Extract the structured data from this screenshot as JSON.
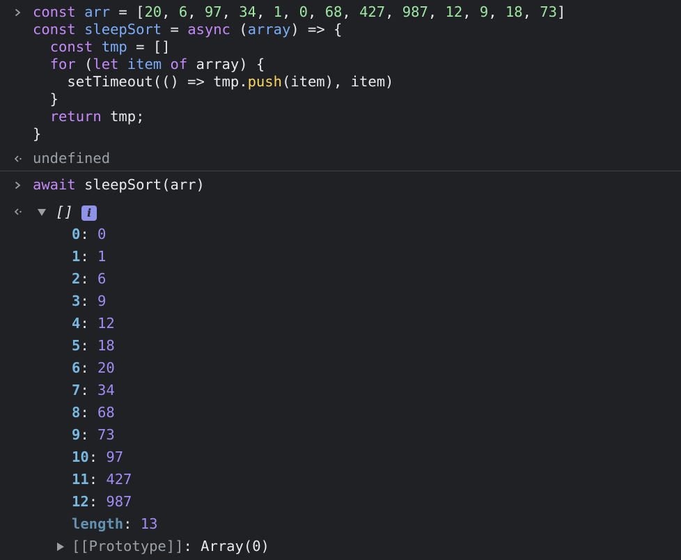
{
  "input1": {
    "lines": [
      [
        [
          "kw",
          "const "
        ],
        [
          "var",
          "arr"
        ],
        [
          "plain",
          " = ["
        ],
        [
          "num",
          "20"
        ],
        [
          "plain",
          ", "
        ],
        [
          "num",
          "6"
        ],
        [
          "plain",
          ", "
        ],
        [
          "num",
          "97"
        ],
        [
          "plain",
          ", "
        ],
        [
          "num",
          "34"
        ],
        [
          "plain",
          ", "
        ],
        [
          "num",
          "1"
        ],
        [
          "plain",
          ", "
        ],
        [
          "num",
          "0"
        ],
        [
          "plain",
          ", "
        ],
        [
          "num",
          "68"
        ],
        [
          "plain",
          ", "
        ],
        [
          "num",
          "427"
        ],
        [
          "plain",
          ", "
        ],
        [
          "num",
          "987"
        ],
        [
          "plain",
          ", "
        ],
        [
          "num",
          "12"
        ],
        [
          "plain",
          ", "
        ],
        [
          "num",
          "9"
        ],
        [
          "plain",
          ", "
        ],
        [
          "num",
          "18"
        ],
        [
          "plain",
          ", "
        ],
        [
          "num",
          "73"
        ],
        [
          "plain",
          "]"
        ]
      ],
      [
        [
          "kw",
          "const "
        ],
        [
          "var",
          "sleepSort"
        ],
        [
          "plain",
          " = "
        ],
        [
          "kw",
          "async"
        ],
        [
          "plain",
          " ("
        ],
        [
          "var",
          "array"
        ],
        [
          "plain",
          ") => {"
        ]
      ],
      [
        [
          "plain",
          "  "
        ],
        [
          "kw",
          "const "
        ],
        [
          "var",
          "tmp"
        ],
        [
          "plain",
          " = []"
        ]
      ],
      [
        [
          "plain",
          "  "
        ],
        [
          "kw",
          "for"
        ],
        [
          "plain",
          " ("
        ],
        [
          "kw",
          "let "
        ],
        [
          "var",
          "item"
        ],
        [
          "plain",
          " "
        ],
        [
          "kw",
          "of"
        ],
        [
          "plain",
          " array) {"
        ]
      ],
      [
        [
          "plain",
          "    setTimeout(() => tmp."
        ],
        [
          "fn",
          "push"
        ],
        [
          "plain",
          "(item), item)"
        ]
      ],
      [
        [
          "plain",
          "  }"
        ]
      ],
      [
        [
          "plain",
          "  "
        ],
        [
          "kw",
          "return"
        ],
        [
          "plain",
          " tmp;"
        ]
      ],
      [
        [
          "plain",
          "}"
        ]
      ]
    ]
  },
  "result1": {
    "text": "undefined"
  },
  "input2": {
    "lines": [
      [
        [
          "kw",
          "await "
        ],
        [
          "plain",
          "sleepSort(arr)"
        ]
      ]
    ]
  },
  "result2": {
    "preview": "[]",
    "info_badge": "i",
    "entries": [
      {
        "key": "0",
        "value": "0"
      },
      {
        "key": "1",
        "value": "1"
      },
      {
        "key": "2",
        "value": "6"
      },
      {
        "key": "3",
        "value": "9"
      },
      {
        "key": "4",
        "value": "12"
      },
      {
        "key": "5",
        "value": "18"
      },
      {
        "key": "6",
        "value": "20"
      },
      {
        "key": "7",
        "value": "34"
      },
      {
        "key": "8",
        "value": "68"
      },
      {
        "key": "9",
        "value": "73"
      },
      {
        "key": "10",
        "value": "97"
      },
      {
        "key": "11",
        "value": "427"
      },
      {
        "key": "12",
        "value": "987"
      }
    ],
    "length_key": "length",
    "length_value": "13",
    "prototype_key": "[[Prototype]]",
    "prototype_value": "Array(0)"
  },
  "icons": {
    "prompt": "chevron-right-icon",
    "result": "return-arrow-icon",
    "expand": "triangle-down-icon",
    "collapse": "triangle-right-icon"
  },
  "colors": {
    "background": "#202124",
    "keyword": "#c58af9",
    "variable": "#7cacf8",
    "number_literal": "#9ee6a3",
    "method": "#fdd663",
    "property_key": "#78b7e0",
    "property_number": "#a28cf6",
    "muted": "#9aa0a6"
  }
}
